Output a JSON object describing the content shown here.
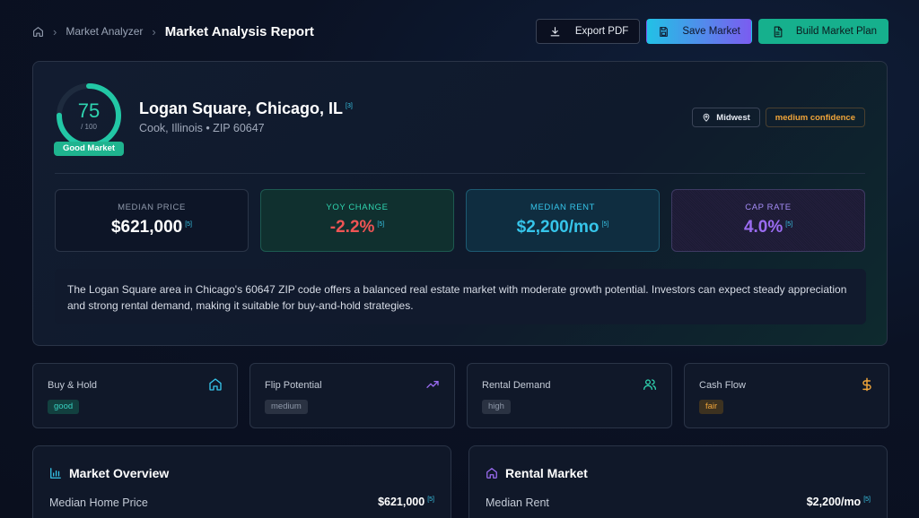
{
  "breadcrumb": {
    "parent": "Market Analyzer",
    "current": "Market Analysis Report"
  },
  "actions": {
    "export": "Export PDF",
    "save": "Save Market",
    "plan": "Build Market Plan"
  },
  "hero": {
    "score": "75",
    "score_max": "/ 100",
    "score_fraction": 0.75,
    "score_label": "Good Market",
    "title": "Logan Square, Chicago, IL",
    "title_ref": "[3]",
    "subtitle": "Cook, Illinois • ZIP 60647",
    "region_tag": "Midwest",
    "confidence_tag": "medium confidence",
    "metrics": [
      {
        "label": "MEDIAN PRICE",
        "value": "$621,000",
        "ref": "[5]"
      },
      {
        "label": "YOY CHANGE",
        "value": "-2.2%",
        "ref": "[5]"
      },
      {
        "label": "MEDIAN RENT",
        "value": "$2,200/mo",
        "ref": "[5]"
      },
      {
        "label": "CAP RATE",
        "value": "4.0%",
        "ref": "[5]"
      }
    ],
    "summary": "The Logan Square area in Chicago's 60647 ZIP code offers a balanced real estate market with moderate growth potential. Investors can expect steady appreciation and strong rental demand, making it suitable for buy-and-hold strategies."
  },
  "strategies": [
    {
      "name": "Buy & Hold",
      "rating": "good",
      "icon": "home-icon"
    },
    {
      "name": "Flip Potential",
      "rating": "medium",
      "icon": "trending-up-icon"
    },
    {
      "name": "Rental Demand",
      "rating": "high",
      "icon": "users-icon"
    },
    {
      "name": "Cash Flow",
      "rating": "fair",
      "icon": "dollar-icon"
    }
  ],
  "market_overview": {
    "title": "Market Overview",
    "row_label": "Median Home Price",
    "row_value": "$621,000",
    "row_ref": "[5]"
  },
  "rental_market": {
    "title": "Rental Market",
    "row_label": "Median Rent",
    "row_value": "$2,200/mo",
    "row_ref": "[5]"
  },
  "colors": {
    "accent_teal": "#2fd5b0",
    "accent_cyan": "#36c5ea",
    "accent_purple": "#9b6cf2",
    "negative": "#ef5454",
    "warning": "#f0a53a"
  }
}
